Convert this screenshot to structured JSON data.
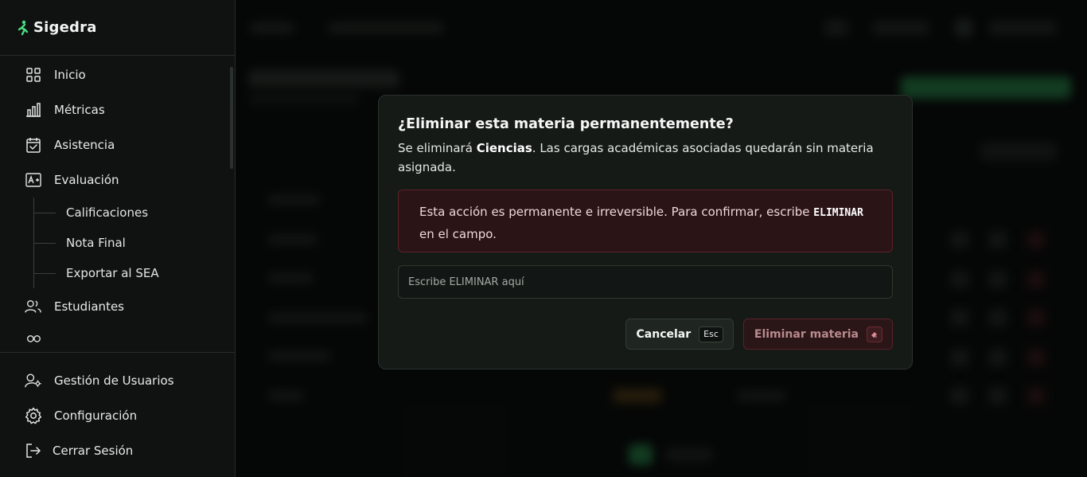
{
  "brand": {
    "name": "Sigedra",
    "accent": "#4ade80"
  },
  "sidebar": {
    "items": [
      {
        "label": "Inicio",
        "icon": "grid-icon"
      },
      {
        "label": "Métricas",
        "icon": "bar-chart-icon"
      },
      {
        "label": "Asistencia",
        "icon": "calendar-check-icon"
      },
      {
        "label": "Evaluación",
        "icon": "grade-icon"
      }
    ],
    "sub_items": [
      {
        "label": "Calificaciones"
      },
      {
        "label": "Nota Final"
      },
      {
        "label": "Exportar al SEA"
      }
    ],
    "more_items": [
      {
        "label": "Estudiantes",
        "icon": "users-icon"
      }
    ],
    "bottom_items": [
      {
        "label": "Gestión de Usuarios",
        "icon": "user-gear-icon"
      },
      {
        "label": "Configuración",
        "icon": "gear-icon"
      },
      {
        "label": "Cerrar Sesión",
        "icon": "logout-icon"
      }
    ]
  },
  "modal": {
    "title": "¿Eliminar esta materia permanentemente?",
    "desc_prefix": "Se eliminará ",
    "subject": "Ciencias",
    "desc_suffix": ". Las cargas académicas asociadas quedarán sin materia asignada.",
    "warning_prefix": "Esta acción es permanente e irreversible. Para confirmar, escribe ",
    "warning_keyword": "ELIMINAR",
    "warning_suffix": " en el campo.",
    "input_placeholder": "Escribe ELIMINAR aquí",
    "input_value": "",
    "cancel_label": "Cancelar",
    "cancel_shortcut": "Esc",
    "delete_label": "Eliminar materia",
    "delete_icon": "eraser-icon",
    "danger_color": "#5a2228"
  }
}
